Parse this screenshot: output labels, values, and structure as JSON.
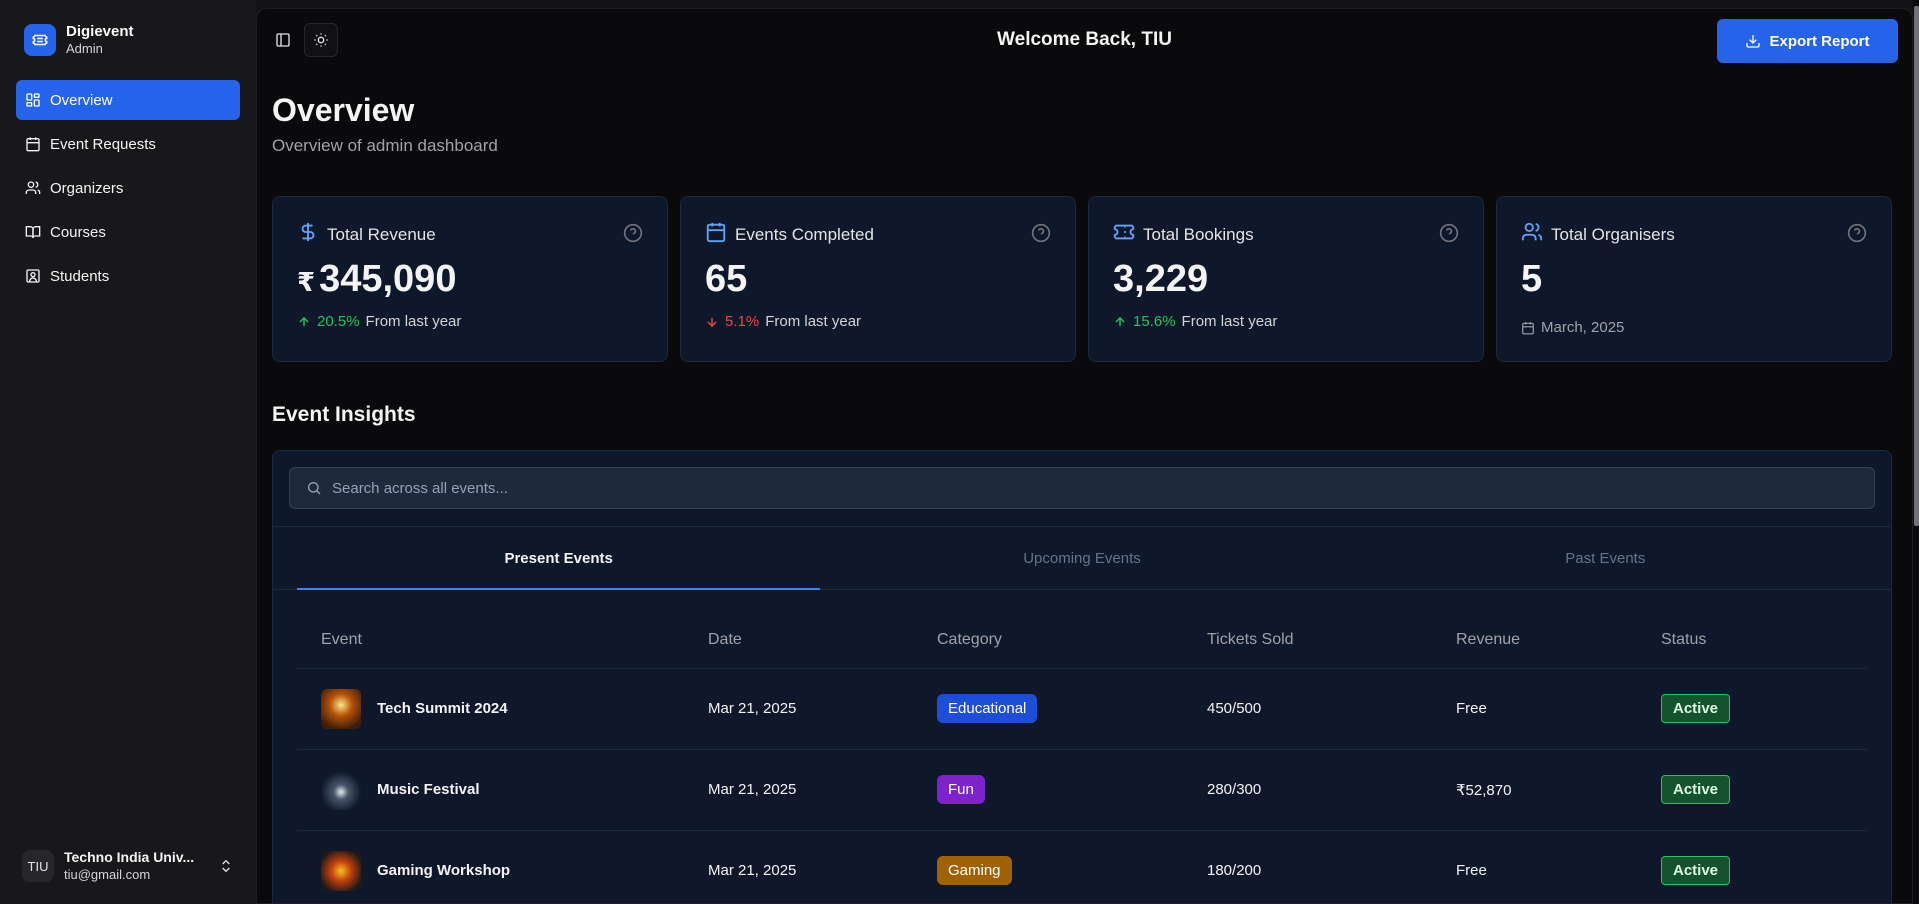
{
  "brand": {
    "name": "Digievent",
    "role": "Admin"
  },
  "sidebar": {
    "items": [
      {
        "label": "Overview",
        "icon": "grid-icon",
        "active": true
      },
      {
        "label": "Event Requests",
        "icon": "calendar-icon"
      },
      {
        "label": "Organizers",
        "icon": "users-icon"
      },
      {
        "label": "Courses",
        "icon": "book-icon"
      },
      {
        "label": "Students",
        "icon": "contact-icon"
      }
    ]
  },
  "user": {
    "initials": "TIU",
    "name": "Techno India Univ...",
    "email": "tiu@gmail.com"
  },
  "header": {
    "welcome": "Welcome Back, TIU",
    "export_label": "Export Report"
  },
  "page": {
    "title": "Overview",
    "subtitle": "Overview of admin dashboard"
  },
  "cards": [
    {
      "title": "Total Revenue",
      "currency": "₹",
      "value": "345,090",
      "change": "20.5%",
      "direction": "up",
      "note": "From last year"
    },
    {
      "title": "Events Completed",
      "value": "65",
      "change": "5.1%",
      "direction": "down",
      "note": "From last year"
    },
    {
      "title": "Total Bookings",
      "value": "3,229",
      "change": "15.6%",
      "direction": "up",
      "note": "From last year"
    },
    {
      "title": "Total Organisers",
      "value": "5",
      "date": "March, 2025"
    }
  ],
  "insights": {
    "title": "Event Insights",
    "search_placeholder": "Search across all events...",
    "tabs": [
      "Present Events",
      "Upcoming Events",
      "Past Events"
    ],
    "columns": [
      "Event",
      "Date",
      "Category",
      "Tickets Sold",
      "Revenue",
      "Status"
    ],
    "rows": [
      {
        "event": "Tech Summit 2024",
        "date": "Mar 21, 2025",
        "category": "Educational",
        "tickets": "450/500",
        "revenue": "Free",
        "status": "Active"
      },
      {
        "event": "Music Festival",
        "date": "Mar 21, 2025",
        "category": "Fun",
        "tickets": "280/300",
        "revenue": "₹52,870",
        "status": "Active"
      },
      {
        "event": "Gaming Workshop",
        "date": "Mar 21, 2025",
        "category": "Gaming",
        "tickets": "180/200",
        "revenue": "Free",
        "status": "Active"
      }
    ]
  },
  "colors": {
    "accent": "#2563eb",
    "educational": "#1d4ed8",
    "fun": "#7e22ce",
    "gaming": "#a16207",
    "positive": "#22c55e",
    "negative": "#ef4444"
  }
}
